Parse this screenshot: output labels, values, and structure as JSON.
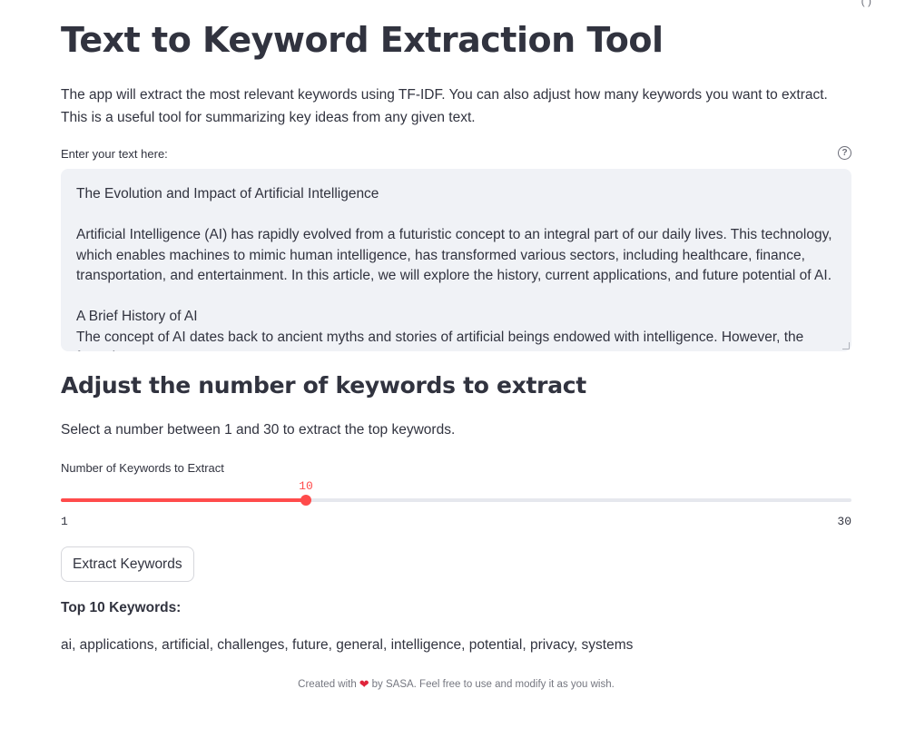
{
  "header": {
    "title": "Text to Keyword Extraction Tool",
    "intro": "The app will extract the most relevant keywords using TF-IDF. You can also adjust how many keywords you want to extract. This is a useful tool for summarizing key ideas from any given text."
  },
  "text_input": {
    "label": "Enter your text here:",
    "help_icon": "question-circle-icon",
    "value": "The Evolution and Impact of Artificial Intelligence\n\nArtificial Intelligence (AI) has rapidly evolved from a futuristic concept to an integral part of our daily lives. This technology, which enables machines to mimic human intelligence, has transformed various sectors, including healthcare, finance, transportation, and entertainment. In this article, we will explore the history, current applications, and future potential of AI.\n\nA Brief History of AI\nThe concept of AI dates back to ancient myths and stories of artificial beings endowed with intelligence. However, the formal"
  },
  "slider_section": {
    "heading": "Adjust the number of keywords to extract",
    "description": "Select a number between 1 and 30 to extract the top keywords.",
    "label": "Number of Keywords to Extract",
    "min": 1,
    "max": 30,
    "value": 10,
    "min_label": "1",
    "max_label": "30",
    "value_label": "10",
    "accent_color": "#ff4b4b"
  },
  "actions": {
    "extract_label": "Extract Keywords"
  },
  "results": {
    "title": "Top 10 Keywords:",
    "keywords": "ai, applications, artificial, challenges, future, general, intelligence, potential, privacy, systems"
  },
  "footer": {
    "prefix": "Created with",
    "heart": "❤",
    "suffix": "by SASA. Feel free to use and modify it as you wish."
  }
}
